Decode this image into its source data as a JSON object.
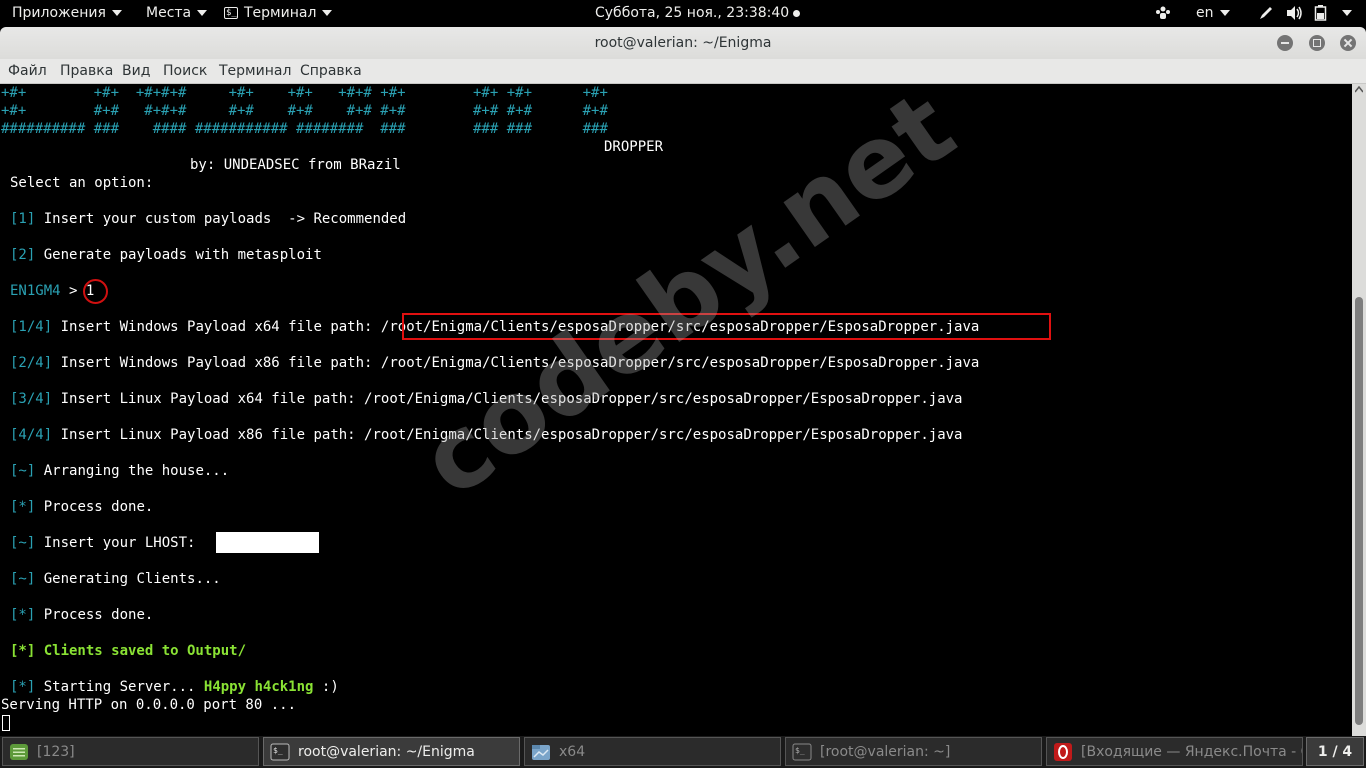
{
  "top_panel": {
    "applications": "Приложения",
    "places": "Места",
    "terminal_app": "Терминал",
    "clock": "Суббота, 25 ноя., 23:38:40",
    "language": "en"
  },
  "window": {
    "title": "root@valerian: ~/Enigma",
    "menu": [
      "Файл",
      "Правка",
      "Вид",
      "Поиск",
      "Терминал",
      "Справка"
    ]
  },
  "terminal": {
    "banner": [
      "+#+        +#+  +#+#+#     +#+    +#+   +#+# +#+        +#+ +#+      +#+",
      "+#+        #+#   #+#+#     #+#    #+#    #+# #+#        #+# #+#      #+#",
      "########## ###    #### ########### ########  ###        ### ###      ###"
    ],
    "dropper": "DROPPER",
    "by": "by: UNDEADSEC from BRazil",
    "select": "Select an option:",
    "opt1_tag": "[1]",
    "opt1": "Insert your custom payloads  -> Recommended",
    "opt2_tag": "[2]",
    "opt2": "Generate payloads with metasploit",
    "prompt": "EN1GM4",
    "prompt_arrow": ">",
    "prompt_input": "1",
    "p1_tag": "[1/4]",
    "p1_label": "Insert Windows Payload x64 file path:",
    "p1_path": "/root/Enigma/Clients/esposaDropper/src/esposaDropper/EsposaDropper.java",
    "p2_tag": "[2/4]",
    "p2_label": "Insert Windows Payload x86 file path:",
    "p2_path": "/root/Enigma/Clients/esposaDropper/src/esposaDropper/EsposaDropper.java",
    "p3_tag": "[3/4]",
    "p3_label": "Insert Linux Payload x64 file path:",
    "p3_path": "/root/Enigma/Clients/esposaDropper/src/esposaDropper/EsposaDropper.java",
    "p4_tag": "[4/4]",
    "p4_label": "Insert Linux Payload x86 file path:",
    "p4_path": "/root/Enigma/Clients/esposaDropper/src/esposaDropper/EsposaDropper.java",
    "arr_tag": "[~]",
    "arranging": "Arranging the house...",
    "done1_tag": "[*]",
    "done1": "Process done.",
    "lhost_tag": "[~]",
    "lhost": "Insert your LHOST:",
    "gen_tag": "[~]",
    "generating": "Generating Clients...",
    "done2_tag": "[*]",
    "done2": "Process done.",
    "saved": "[*] Clients saved to Output/",
    "start_tag": "[*]",
    "starting": "Starting Server...",
    "happy": "H4ppy h4ck1ng",
    "smile": ":)",
    "serving": "Serving HTTP on 0.0.0.0 port 80 ..."
  },
  "watermark": "codeby.net",
  "taskbar": {
    "tasks": [
      {
        "label": "[123]",
        "icon": "text-editor-icon"
      },
      {
        "label": "root@valerian: ~/Enigma",
        "icon": "terminal-icon"
      },
      {
        "label": "x64",
        "icon": "folder-icon"
      },
      {
        "label": "[root@valerian: ~]",
        "icon": "terminal-icon"
      },
      {
        "label": "[Входящие — Яндекс.Почта - Op…",
        "icon": "opera-icon"
      }
    ],
    "workspace": "1 / 4"
  },
  "colors": {
    "teal": "#2aa1b3",
    "lime": "#8ae234",
    "annotation_red": "#e01010"
  }
}
